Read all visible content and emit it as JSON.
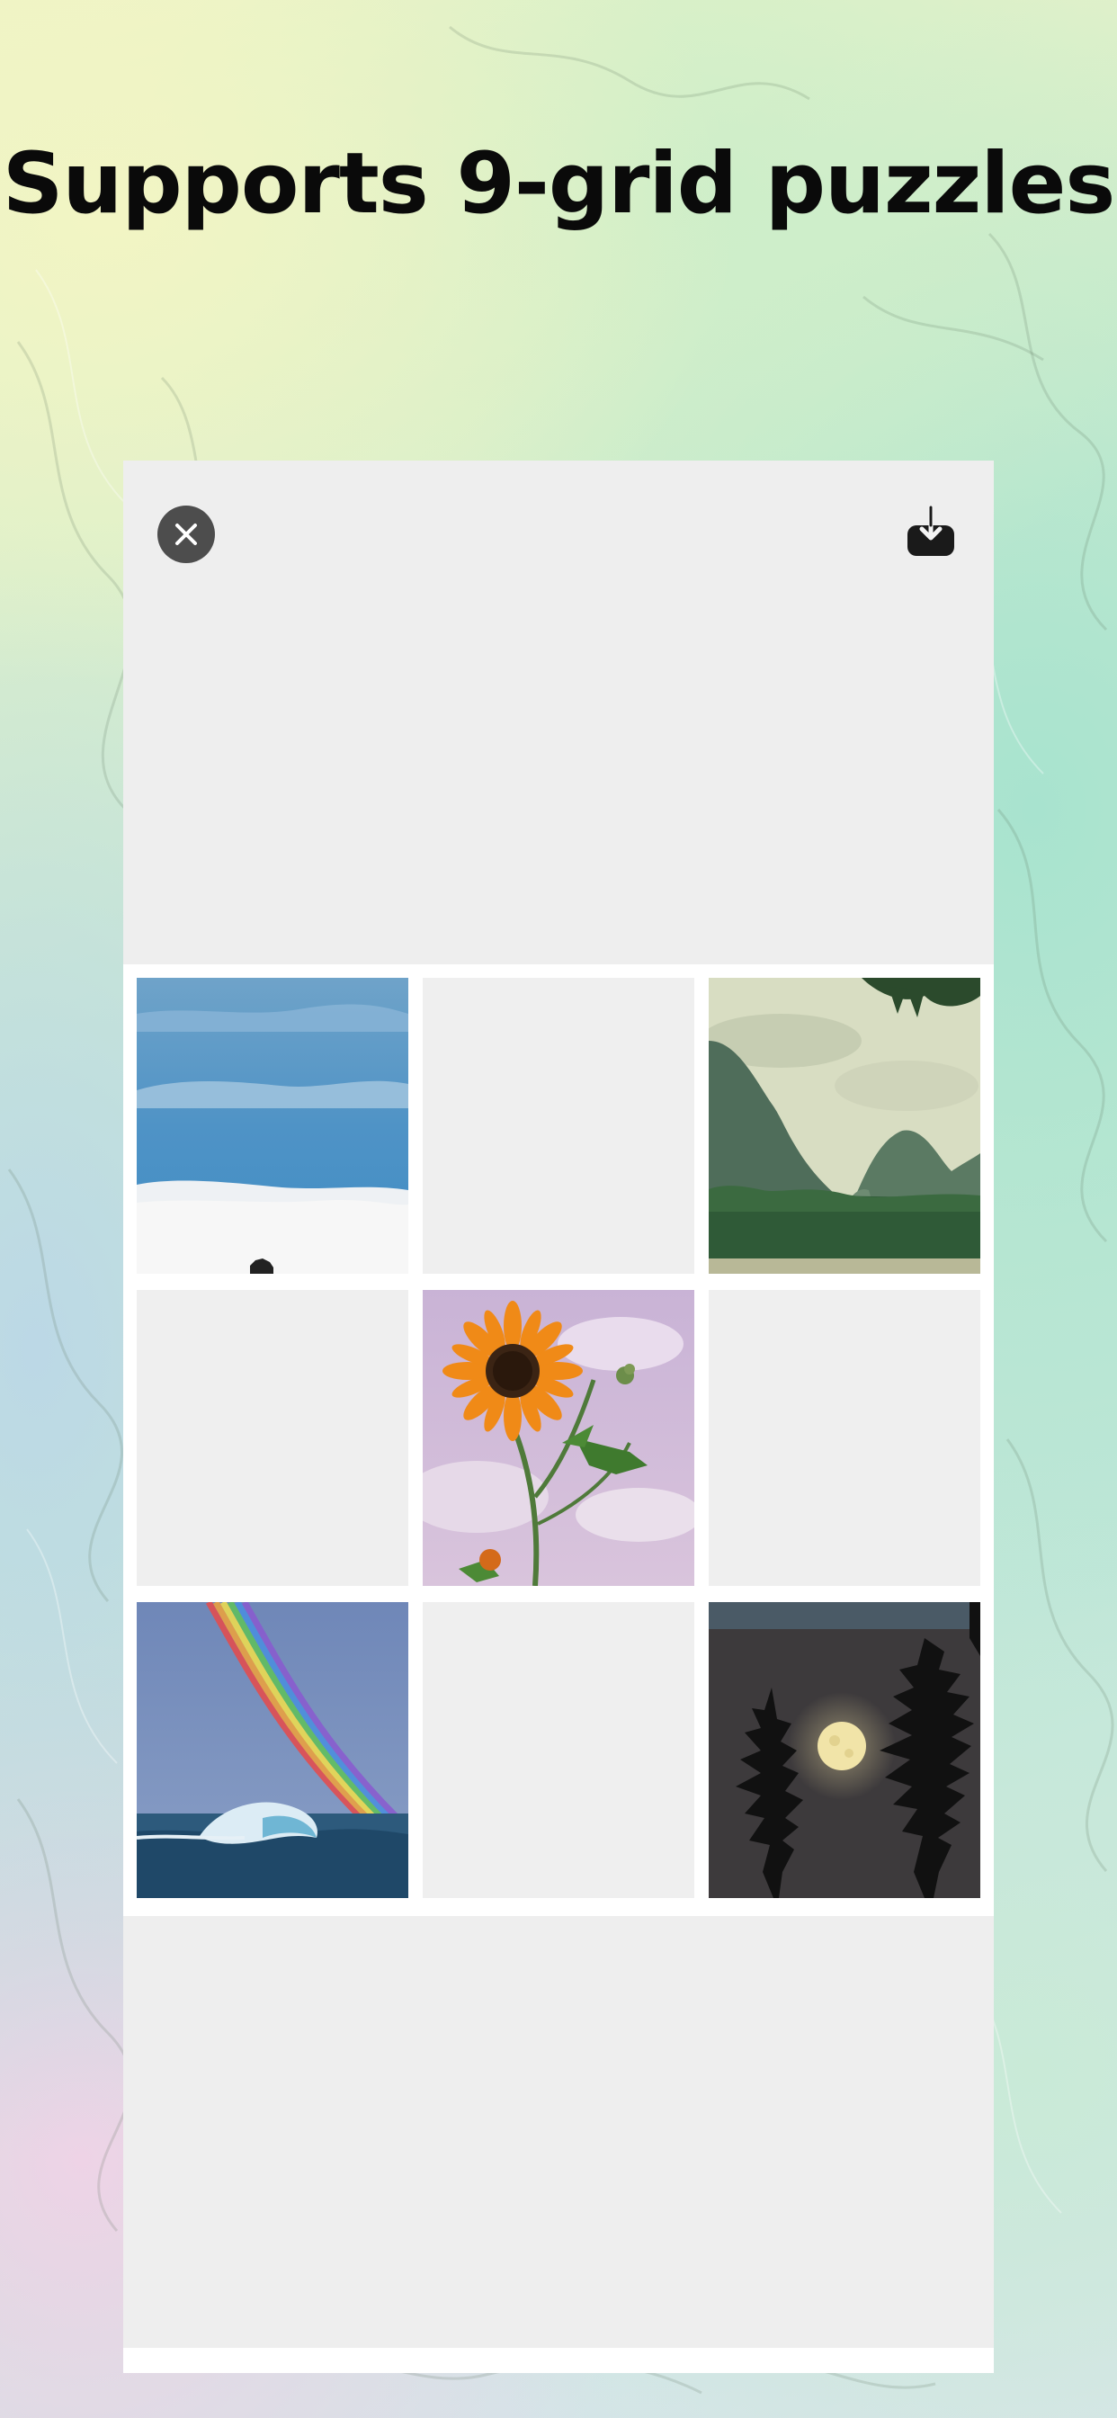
{
  "headline": "Supports 9-grid puzzles",
  "toolbar": {
    "close_icon": "close-icon",
    "save_icon": "download-icon"
  },
  "grid": {
    "rows": 3,
    "columns": 3,
    "cells": [
      {
        "content": "sky-clouds-photo"
      },
      {
        "content": "empty"
      },
      {
        "content": "karst-mountains-photo"
      },
      {
        "content": "empty"
      },
      {
        "content": "sunflower-photo"
      },
      {
        "content": "empty"
      },
      {
        "content": "rainbow-wave-photo"
      },
      {
        "content": "empty"
      },
      {
        "content": "moon-trees-photo"
      }
    ]
  },
  "colors": {
    "panel": "#eeeeee",
    "grid_background": "#ffffff",
    "empty_cell": "#efefef",
    "close_button": "#4d4d4d"
  }
}
